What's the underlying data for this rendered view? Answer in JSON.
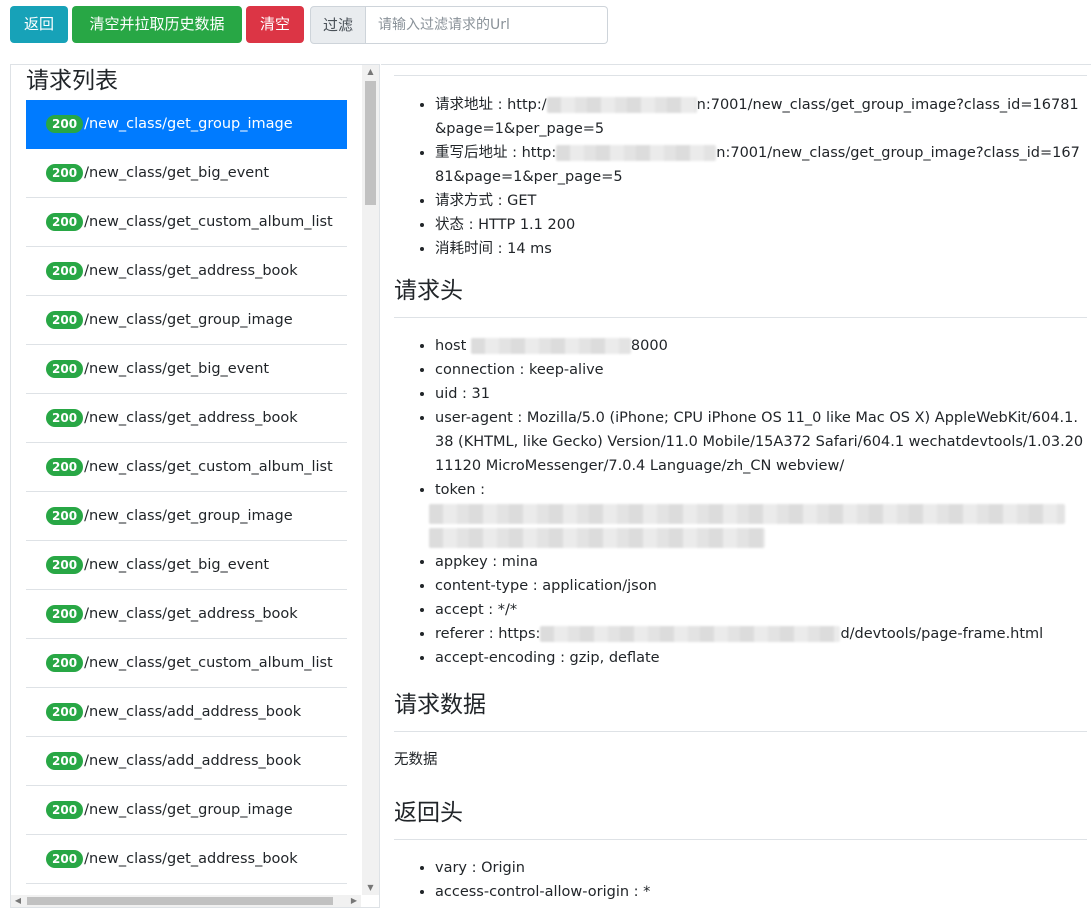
{
  "toolbar": {
    "back_label": "返回",
    "clear_fetch_label": "清空并拉取历史数据",
    "clear_label": "清空",
    "filter_label": "过滤",
    "filter_placeholder": "请输入过滤请求的Url",
    "colors": {
      "info": "#17a2b8",
      "success": "#28a745",
      "danger": "#dc3545"
    }
  },
  "request_list": {
    "title": "请求列表",
    "active_index": 0,
    "items": [
      {
        "status": "200",
        "path": "/new_class/get_group_image"
      },
      {
        "status": "200",
        "path": "/new_class/get_big_event"
      },
      {
        "status": "200",
        "path": "/new_class/get_custom_album_list"
      },
      {
        "status": "200",
        "path": "/new_class/get_address_book"
      },
      {
        "status": "200",
        "path": "/new_class/get_group_image"
      },
      {
        "status": "200",
        "path": "/new_class/get_big_event"
      },
      {
        "status": "200",
        "path": "/new_class/get_address_book"
      },
      {
        "status": "200",
        "path": "/new_class/get_custom_album_list"
      },
      {
        "status": "200",
        "path": "/new_class/get_group_image"
      },
      {
        "status": "200",
        "path": "/new_class/get_big_event"
      },
      {
        "status": "200",
        "path": "/new_class/get_address_book"
      },
      {
        "status": "200",
        "path": "/new_class/get_custom_album_list"
      },
      {
        "status": "200",
        "path": "/new_class/add_address_book"
      },
      {
        "status": "200",
        "path": "/new_class/add_address_book"
      },
      {
        "status": "200",
        "path": "/new_class/get_group_image"
      },
      {
        "status": "200",
        "path": "/new_class/get_address_book"
      }
    ],
    "active_color": "#007bff",
    "badge_color": "#28a745"
  },
  "detail": {
    "general": {
      "url_label": "请求地址 : ",
      "url_prefix": "http:/",
      "url_suffix": "n:7001/new_class/get_group_image?class_id=16781&page=1&per_page=5",
      "rewrite_label": "重写后地址 : ",
      "rewrite_prefix": "http:",
      "rewrite_suffix": "n:7001/new_class/get_group_image?class_id=16781&page=1&per_page=5",
      "method": "请求方式 : GET",
      "status": "状态 : HTTP 1.1 200",
      "time": "消耗时间 : 14 ms"
    },
    "request_headers": {
      "title": "请求头",
      "host_label": "host ",
      "host_suffix": "8000",
      "connection": "connection : keep-alive",
      "uid": "uid : 31",
      "user_agent": "user-agent : Mozilla/5.0 (iPhone; CPU iPhone OS 11_0 like Mac OS X) AppleWebKit/604.1.38 (KHTML, like Gecko) Version/11.0 Mobile/15A372 Safari/604.1 wechatdevtools/1.03.2011120 MicroMessenger/7.0.4 Language/zh_CN webview/",
      "token_label": "token :",
      "appkey": "appkey : mina",
      "content_type": "content-type : application/json",
      "accept": "accept : */*",
      "referer_label": "referer : https:",
      "referer_suffix": "d/devtools/page-frame.html",
      "accept_encoding": "accept-encoding : gzip, deflate"
    },
    "request_data": {
      "title": "请求数据",
      "empty": "无数据"
    },
    "response_headers": {
      "title": "返回头",
      "vary": "vary : Origin",
      "acao": "access-control-allow-origin : *"
    }
  }
}
